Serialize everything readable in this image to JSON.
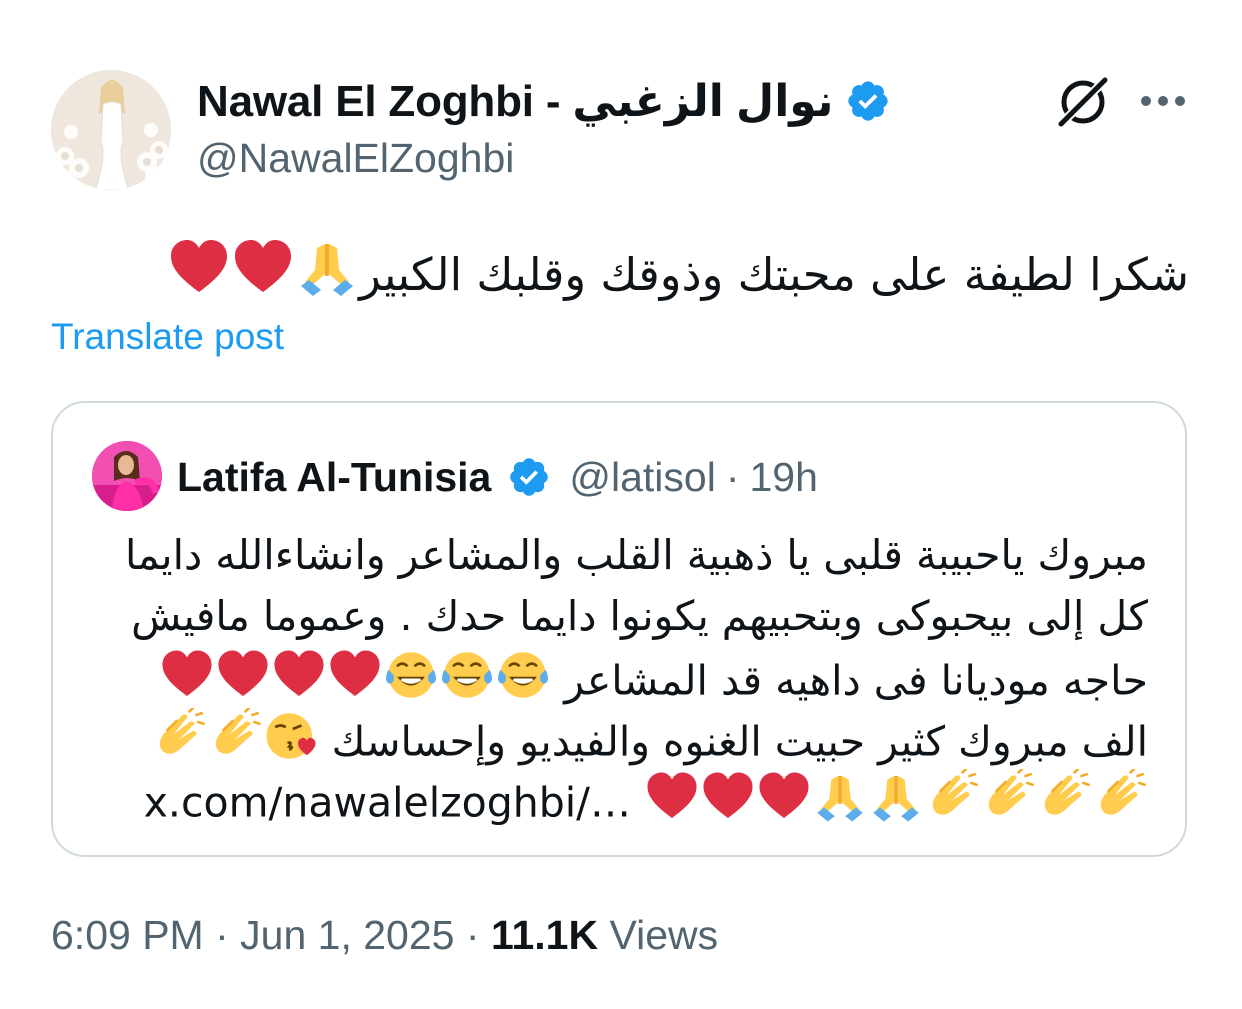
{
  "author": {
    "name": "Nawal El Zoghbi - نوال الزغبي",
    "handle": "@NawalElZoghbi",
    "verified_color": "#1d9bf0"
  },
  "post": {
    "text": "شكرا لطيفة على محبتك وذوقك وقلبك الكبير",
    "emojis": [
      "folded-hands",
      "red-heart",
      "red-heart"
    ]
  },
  "translate_label": "Translate post",
  "quote": {
    "name": "Latifa Al-Tunisia",
    "handle": "@latisol",
    "separator": "·",
    "time": "19h",
    "lines": [
      {
        "text": "مبروك ياحبيبة قلبى يا ذهبية القلب والمشاعر وانشاءالله دايما"
      },
      {
        "text": "كل إلى بيحبوكى وبتحبيهم يكونوا دايما حدك . وعموما مافيش"
      },
      {
        "text": "حاجه موديانا فى داهيه قد المشاعر",
        "emojis": [
          "face-with-tears-of-joy",
          "face-with-tears-of-joy",
          "face-with-tears-of-joy",
          "red-heart",
          "red-heart",
          "red-heart",
          "red-heart"
        ]
      },
      {
        "text": "الف مبروك كثير حبيت الغنوه والفيديو وإحساسك",
        "emojis": [
          "face-blowing-kiss",
          "clapping-hands",
          "clapping-hands"
        ]
      },
      {
        "link": "x.com/nawalelzoghbi/…",
        "emojis": [
          "clapping-hands",
          "clapping-hands",
          "clapping-hands",
          "clapping-hands",
          "folded-hands",
          "folded-hands",
          "red-heart",
          "red-heart",
          "red-heart"
        ]
      }
    ]
  },
  "meta": {
    "time": "6:09 PM",
    "date": "Jun 1, 2025",
    "separator": "·",
    "views_count": "11.1K",
    "views_label": "Views"
  },
  "colors": {
    "text": "#0f1419",
    "secondary": "#536471",
    "link": "#1d9bf0",
    "border": "#cfd9de",
    "heart": "#dd2e44"
  }
}
